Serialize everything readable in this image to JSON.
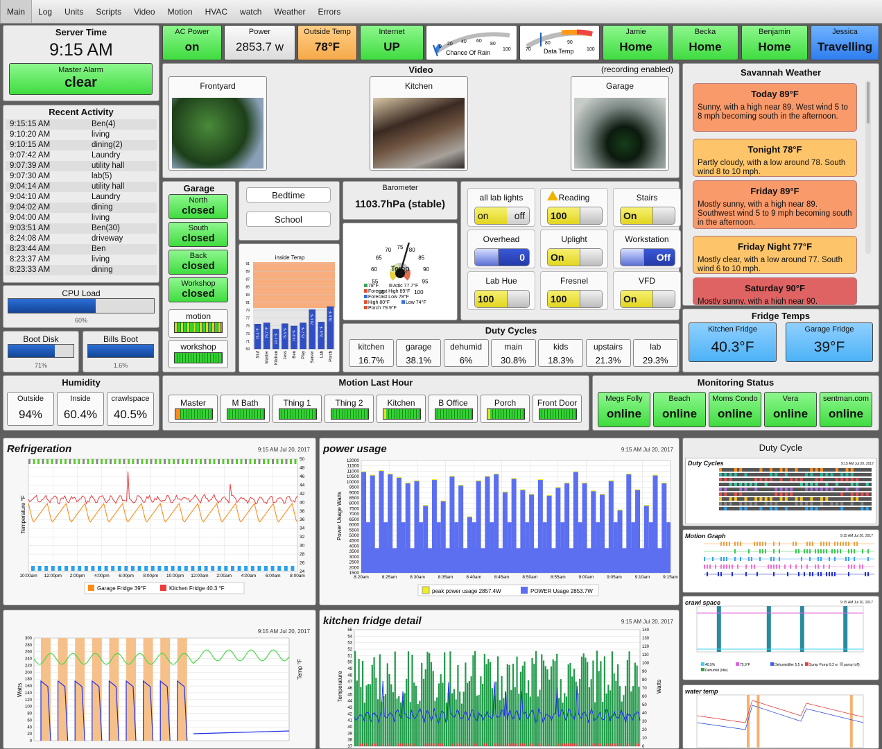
{
  "tabs": [
    "Main",
    "Log",
    "Units",
    "Scripts",
    "Video",
    "Motion",
    "HVAC",
    "watch",
    "Weather",
    "Errors"
  ],
  "server": {
    "title": "Server Time",
    "time": "9:15 AM",
    "alarm_label": "Master Alarm",
    "alarm_value": "clear"
  },
  "status": {
    "ac_label": "AC Power",
    "ac_value": "on",
    "power_label": "Power",
    "power_value": "2853.7 w",
    "outside_label": "Outside Temp",
    "outside_value": "78°F",
    "internet_label": "Internet",
    "internet_value": "UP"
  },
  "gauges": {
    "rain": {
      "label": "Chance Of Rain",
      "ticks": [
        "0",
        "20",
        "40",
        "60",
        "80",
        "100"
      ]
    },
    "data": {
      "label": "Data Temp",
      "ticks": [
        "70",
        "80",
        "90",
        "100"
      ]
    }
  },
  "people": [
    {
      "name": "Jamie",
      "state": "Home"
    },
    {
      "name": "Becka",
      "state": "Home"
    },
    {
      "name": "Benjamin",
      "state": "Home"
    },
    {
      "name": "Jessica",
      "state": "Travelling"
    }
  ],
  "activity": {
    "title": "Recent Activity",
    "rows": [
      [
        "9:15:15 AM",
        "Ben(4)"
      ],
      [
        "9:10:20 AM",
        "living"
      ],
      [
        "9:10:15 AM",
        "dining(2)"
      ],
      [
        "9:07:42 AM",
        "Laundry"
      ],
      [
        "9:07:39 AM",
        "utility hall"
      ],
      [
        "9:07:30 AM",
        "lab(5)"
      ],
      [
        "9:04:14 AM",
        "utility hall"
      ],
      [
        "9:04:10 AM",
        "Laundry"
      ],
      [
        "9:04:02 AM",
        "dining"
      ],
      [
        "9:04:00 AM",
        "living"
      ],
      [
        "9:03:51 AM",
        "Ben(30)"
      ],
      [
        "8:24:08 AM",
        "driveway"
      ],
      [
        "8:23:44 AM",
        "Ben"
      ],
      [
        "8:23:37 AM",
        "living"
      ],
      [
        "8:23:33 AM",
        "dining"
      ]
    ]
  },
  "cpu": {
    "title": "CPU Load",
    "value": "60%",
    "fraction": 0.6
  },
  "disks": [
    {
      "title": "Boot Disk",
      "value": "71%",
      "fraction": 0.71
    },
    {
      "title": "Bills Boot",
      "value": "1.6%",
      "fraction": 0.016
    }
  ],
  "video": {
    "title": "Video",
    "note": "(recording enabled)",
    "cams": [
      "Frontyard",
      "Kitchen",
      "Garage"
    ]
  },
  "garage": {
    "title": "Garage",
    "doors": [
      {
        "name": "North",
        "state": "closed"
      },
      {
        "name": "South",
        "state": "closed"
      },
      {
        "name": "Back",
        "state": "closed"
      },
      {
        "name": "Workshop",
        "state": "closed"
      }
    ],
    "motion": "motion",
    "workshop": "workshop"
  },
  "modes": [
    "Bedtime",
    "School"
  ],
  "inside_temp": {
    "title": "inside Temp",
    "rooms": [
      "Stuf",
      "Master",
      "Kitchen",
      "Jess",
      "Ben",
      "Play",
      "Server",
      "Lab",
      "Porch"
    ],
    "values": [
      75.4,
      75.7,
      74.1,
      75.5,
      74.9,
      75.7,
      79.1,
      75.9,
      79.9
    ],
    "labels": [
      "75.4 °F",
      "75.7 °F",
      "74.1 °F",
      "75.5 °F",
      "74.9 °F",
      "75.7 °F",
      "79.1 °F",
      "75.9 °F",
      "79.9 °F"
    ],
    "yticks": [
      "91",
      "89",
      "87",
      "85",
      "83",
      "81",
      "79",
      "77",
      "75",
      "73",
      "71",
      "69"
    ]
  },
  "barometer": {
    "title": "Barometer",
    "value": "1103.7hPa (stable)"
  },
  "thermo": {
    "title": "Temp",
    "ticks": [
      "50",
      "55",
      "60",
      "65",
      "70",
      "75",
      "80",
      "85",
      "90",
      "95",
      "100"
    ],
    "legend": [
      "78°F",
      "Attic 77.7°F",
      "Forecast High 89°F",
      "Forecast Low 78°F",
      "High 80°F",
      "Low 74°F",
      "Porch 79.9°F"
    ]
  },
  "switches": [
    {
      "name": "all lab lights",
      "left": "on",
      "right": "off",
      "type": "onoff"
    },
    {
      "name": "Reading",
      "left": "100",
      "type": "dim",
      "warn": true
    },
    {
      "name": "Stairs",
      "left": "On",
      "type": "dim"
    },
    {
      "name": "Overhead",
      "right": "0",
      "type": "off"
    },
    {
      "name": "Uplight",
      "left": "On",
      "type": "dim"
    },
    {
      "name": "Workstation",
      "right": "Off",
      "type": "off"
    },
    {
      "name": "Lab Hue",
      "left": "100",
      "type": "dim"
    },
    {
      "name": "Fresnel",
      "left": "100",
      "type": "dim"
    },
    {
      "name": "VFD",
      "left": "On",
      "type": "dim"
    }
  ],
  "duty": {
    "title": "Duty Cycles",
    "items": [
      {
        "name": "kitchen",
        "value": "16.7%"
      },
      {
        "name": "garage",
        "value": "38.1%"
      },
      {
        "name": "dehumid",
        "value": "6%"
      },
      {
        "name": "main",
        "value": "30.8%"
      },
      {
        "name": "kids",
        "value": "18.3%"
      },
      {
        "name": "upstairs",
        "value": "21.3%"
      },
      {
        "name": "lab",
        "value": "29.3%"
      }
    ]
  },
  "weather": {
    "title": "Savannah Weather",
    "cards": [
      {
        "h": "Today 89°F",
        "b": "Sunny, with a high near 89. West wind 5 to 8 mph becoming south in the afternoon.",
        "c": "#f99a6b"
      },
      {
        "h": "Tonight 78°F",
        "b": "Partly cloudy, with a low around 78. South wind 8 to 10 mph.",
        "c": "#fdc46a"
      },
      {
        "h": "Friday 89°F",
        "b": "Mostly sunny, with a high near 89. Southwest wind 5 to 9 mph becoming south in the afternoon.",
        "c": "#f99a6b"
      },
      {
        "h": "Friday Night 77°F",
        "b": "Mostly clear, with a low around 77. South wind 6 to 10 mph.",
        "c": "#fdc46a"
      },
      {
        "h": "Saturday 90°F",
        "b": "Mostly sunny, with a high near 90.",
        "c": "#e06363"
      }
    ]
  },
  "fridge": {
    "title": "Fridge Temps",
    "items": [
      {
        "name": "Kitchen Fridge",
        "value": "40.3°F"
      },
      {
        "name": "Garage Fridge",
        "value": "39°F"
      }
    ]
  },
  "humidity": {
    "title": "Humidity",
    "items": [
      {
        "name": "Outside",
        "value": "94%"
      },
      {
        "name": "Inside",
        "value": "60.4%"
      },
      {
        "name": "crawlspace",
        "value": "40.5%"
      }
    ]
  },
  "motion_hour": {
    "title": "Motion Last Hour",
    "items": [
      "Master",
      "M Bath",
      "Thing 1",
      "Thing 2",
      "Kitchen",
      "B Office",
      "Porch",
      "Front Door"
    ]
  },
  "monitoring": {
    "title": "Monitoring Status",
    "items": [
      {
        "name": "Megs Folly",
        "state": "online"
      },
      {
        "name": "Beach",
        "state": "online"
      },
      {
        "name": "Moms Condo",
        "state": "online"
      },
      {
        "name": "Vera",
        "state": "online"
      },
      {
        "name": "sentman.com",
        "state": "online"
      }
    ]
  },
  "charts": {
    "refrig": {
      "title": "Refrigeration",
      "time": "9:15 AM Jul 20, 2017",
      "ylabel": "Temperature °F",
      "xticks": [
        "10:00am",
        "12:00pm",
        "2:00pm",
        "4:00pm",
        "6:00pm",
        "8:00pm",
        "10:00pm",
        "12:00am",
        "2:00am",
        "4:00am",
        "6:00am",
        "8:00am"
      ],
      "yticks": [
        "50",
        "48",
        "46",
        "44",
        "42",
        "40",
        "38",
        "36",
        "34",
        "32",
        "30",
        "28",
        "26",
        "24"
      ],
      "legend": [
        "Garage Fridge 39°F",
        "Kitchen Fridge 40.3 °F"
      ]
    },
    "power": {
      "title": "power usage",
      "time": "9:15 AM Jul 20, 2017",
      "ylabel": "Power Usage Watts",
      "xticks": [
        "8:20am",
        "8:25am",
        "8:30am",
        "8:35am",
        "8:40am",
        "8:45am",
        "8:50am",
        "8:55am",
        "9:00am",
        "9:05am",
        "9:10am",
        "9:15am"
      ],
      "yticks": [
        "12000",
        "11500",
        "11000",
        "10500",
        "10000",
        "9500",
        "9000",
        "8500",
        "8000",
        "7500",
        "7000",
        "6500",
        "6000",
        "5500",
        "5000",
        "4500",
        "4000",
        "3500",
        "3000",
        "2500",
        "2000",
        "1500"
      ],
      "legend": [
        "peak power usage 2857.4W",
        "POWER Usage 2853.7W"
      ]
    },
    "duty": {
      "title": "Duty Cycle",
      "sub": "Duty Cycles",
      "time": "9:15 AM Jul 20, 2017"
    },
    "motion": {
      "sub": "Motion Graph",
      "time": "9:15 AM Jul 20, 2017"
    },
    "crawl": {
      "sub": "crawl space",
      "time": "9:15 AM Jul 20, 2017",
      "legend": [
        "40.5%",
        "75.9°F",
        "Dehumidifier 5.5 w",
        "Sump Pump 9.2 w",
        "pump (off)",
        "Dehumid (idle)"
      ]
    },
    "water": {
      "sub": "water temp"
    },
    "garage_power": {
      "time": "9:15 AM Jul 20, 2017",
      "ylabel": "Watts",
      "ylabel2": "Temp °F",
      "yticks": [
        "300",
        "280",
        "260",
        "240",
        "220",
        "200",
        "180",
        "160",
        "140",
        "120",
        "100",
        "80",
        "60",
        "40",
        "20",
        "0"
      ]
    },
    "kfridge": {
      "title": "kitchen fridge detail",
      "time": "9:15 AM Jul 20, 2017",
      "ylabel": "Temperature",
      "ylabel2": "Watts",
      "yticks": [
        "55",
        "54",
        "53",
        "52",
        "51",
        "50",
        "49",
        "48",
        "47",
        "46",
        "45",
        "44",
        "43",
        "42",
        "41",
        "40",
        "39",
        "38",
        "37"
      ],
      "yticks2": [
        "140",
        "130",
        "120",
        "110",
        "100",
        "90",
        "80",
        "70",
        "60",
        "50",
        "40",
        "30",
        "20",
        "10",
        "0"
      ]
    }
  },
  "colors": {
    "green": "#3fdc3f",
    "orange": "#f6a94a",
    "blue": "#2f7ef0",
    "red": "#ef4444",
    "accent_orange": "#ff8c1a"
  }
}
